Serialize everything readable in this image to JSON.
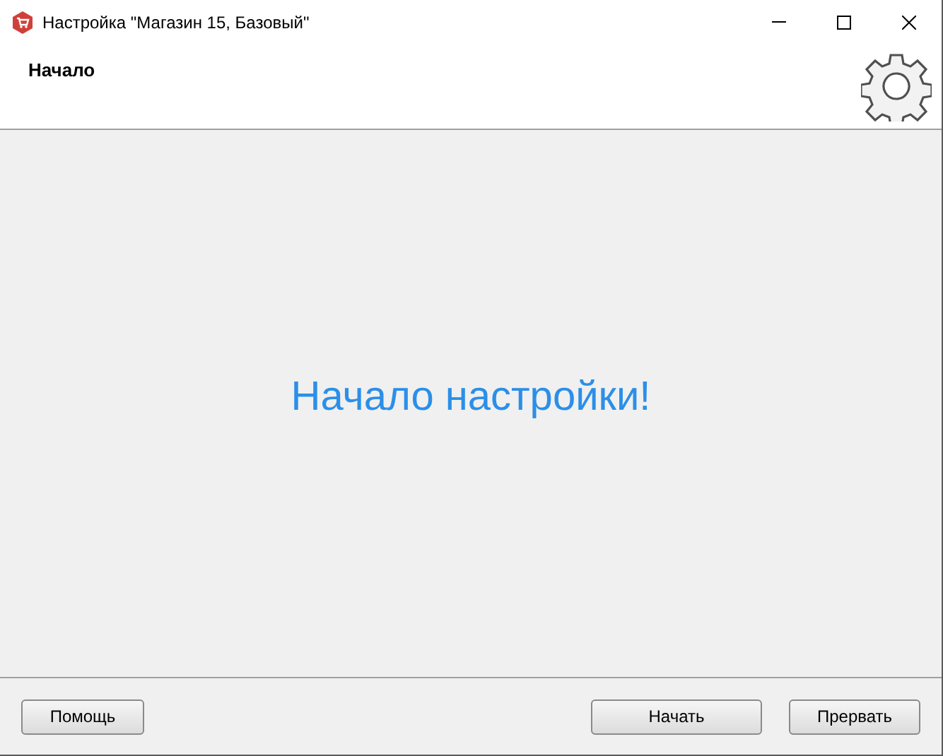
{
  "window": {
    "title": "Настройка \"Магазин 15, Базовый\""
  },
  "header": {
    "title": "Начало"
  },
  "content": {
    "heading": "Начало настройки!"
  },
  "buttons": [
    {
      "label": "Помощь",
      "kind": "left"
    },
    {
      "label": "Начать",
      "kind": "right"
    },
    {
      "label": "Прервать",
      "kind": "right"
    }
  ]
}
